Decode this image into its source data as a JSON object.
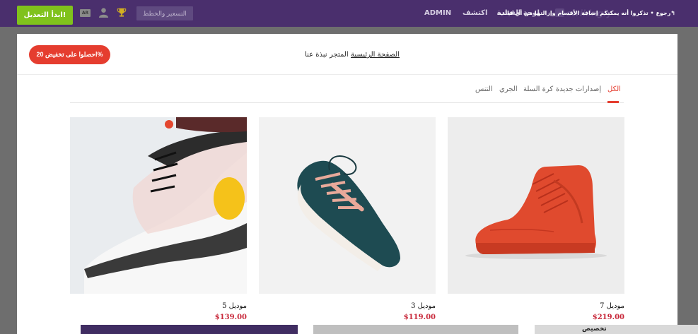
{
  "topbar": {
    "start_button": "ابدأ التعديل!",
    "lang_badge": "AR",
    "pricing_button": "التسعير والخطط",
    "nav": [
      "ADMIN",
      "اكتشف",
      "لوحة القيادة"
    ],
    "logo_text": "strikingly",
    "back_note": "↰رجوع • تذكروا أنه يمكنكم إضافة الأقسام وإزالتها من أي قالب."
  },
  "modal": {
    "discount_button": "احصلوا على تخفيض 20%",
    "header_nav": [
      {
        "label": "الصفحة الرئيسية",
        "active": true
      },
      {
        "label": "المتجر",
        "active": false
      },
      {
        "label": "نبذة عنا",
        "active": false
      }
    ],
    "tabs": [
      {
        "label": "الكل",
        "active": true
      },
      {
        "label": "إصدارات جديدة",
        "active": false
      },
      {
        "label": "كرة السلة",
        "active": false
      },
      {
        "label": "الجري",
        "active": false
      },
      {
        "label": "التنس",
        "active": false
      }
    ],
    "products": [
      {
        "name": "موديل 7",
        "price": "$219.00",
        "image": "red-high-top-sneaker"
      },
      {
        "name": "موديل 3",
        "price": "$119.00",
        "image": "dark-teal-running-shoe"
      },
      {
        "name": "موديل 5",
        "price": "$139.00",
        "image": "white-sneaker-closeup"
      }
    ]
  },
  "underlay": {
    "side_label": "تخصيص"
  },
  "colors": {
    "topbar": "#4a2f6d",
    "accent_red": "#e53d2f",
    "start_green": "#80c21c",
    "price_red": "#c8283a"
  }
}
